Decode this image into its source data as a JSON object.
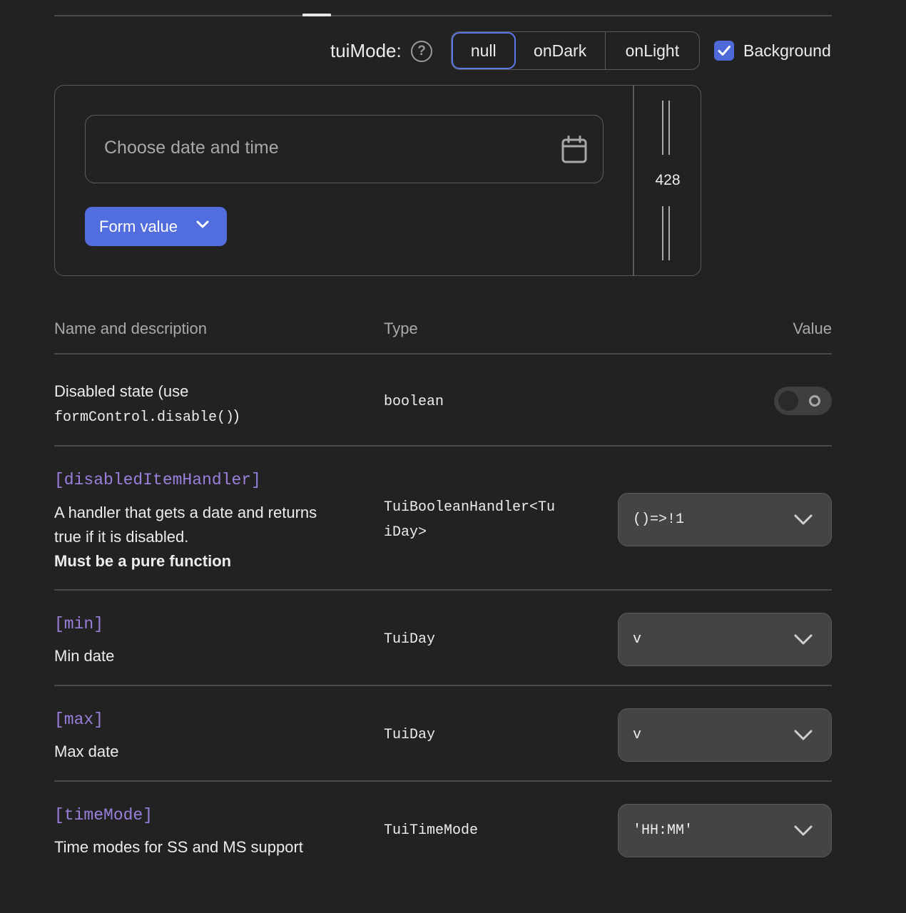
{
  "mode_selector": {
    "label": "tuiMode:",
    "options": [
      "null",
      "onDark",
      "onLight"
    ],
    "selected": "null"
  },
  "background": {
    "label": "Background",
    "checked": true
  },
  "demo": {
    "date_input_placeholder": "Choose date and time",
    "form_value_button": "Form value",
    "width_value": "428"
  },
  "table": {
    "headers": {
      "name": "Name and description",
      "type": "Type",
      "value": "Value"
    },
    "rows": [
      {
        "desc_line1": "Disabled state (use",
        "desc_code": "formControl.disable()",
        "desc_close": ")",
        "type": "boolean",
        "control": "toggle",
        "toggle_on": false
      },
      {
        "name": "[disabledItemHandler]",
        "desc_line1": "A handler that gets a date and returns",
        "desc_line2": "true if it is disabled.",
        "desc_bold": "Must be a pure function",
        "type_line1": "TuiBooleanHandler<Tu",
        "type_line2": "iDay>",
        "value": "()=>!1"
      },
      {
        "name": "[min]",
        "desc": "Min date",
        "type": "TuiDay",
        "value": "v"
      },
      {
        "name": "[max]",
        "desc": "Max date",
        "type": "TuiDay",
        "value": "v"
      },
      {
        "name": "[timeMode]",
        "desc": "Time modes for SS and MS support",
        "type": "TuiTimeMode",
        "value": "'HH:MM'"
      }
    ]
  },
  "colors": {
    "background": "#222222",
    "accent": "#526ddd",
    "property_name": "#9a7fdc",
    "border": "#5a5a5a"
  },
  "icons": [
    "help-icon",
    "checkmark-icon",
    "calendar-icon",
    "chevron-down-icon"
  ]
}
